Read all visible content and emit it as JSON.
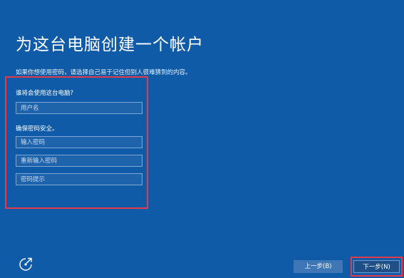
{
  "page": {
    "title": "为这台电脑创建一个帐户",
    "subtitle": "如果你想使用密码，请选择自己易于记住但别人很难猜到的内容。"
  },
  "form": {
    "who_label": "谁将会使用这台电脑?",
    "username_placeholder": "用户名",
    "secure_label": "确保密码安全。",
    "password_placeholder": "输入密码",
    "reenter_placeholder": "重新输入密码",
    "hint_placeholder": "密码提示"
  },
  "footer": {
    "ease_icon": "ease-of-access-icon",
    "back_label": "上一步(B)",
    "next_label": "下一步(N)"
  },
  "colors": {
    "background": "#0f5ba8",
    "highlight": "#e53b48"
  }
}
